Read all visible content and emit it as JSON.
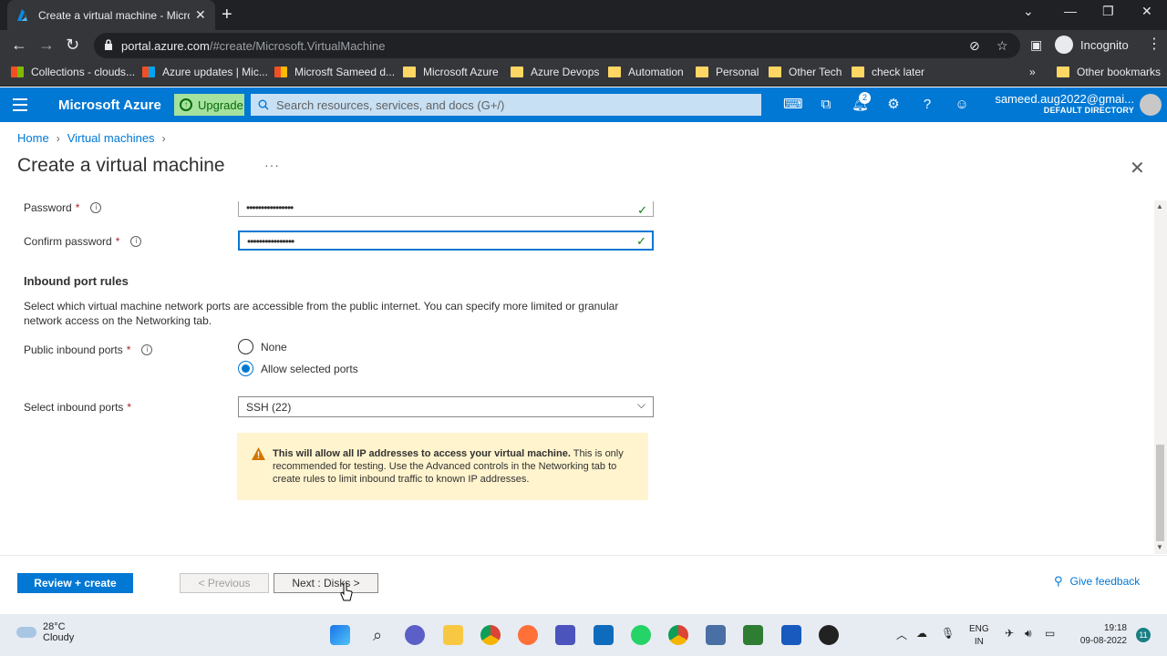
{
  "browser": {
    "tab_title": "Create a virtual machine - Micro",
    "url_host": "portal.azure.com",
    "url_path": "/#create/Microsoft.VirtualMachine",
    "profile": "Incognito",
    "bookmarks": [
      "Collections - clouds...",
      "Azure updates | Mic...",
      "Microsft Sameed d...",
      "Microsoft Azure",
      "Azure Devops",
      "Automation",
      "Personal",
      "Other Tech",
      "check later"
    ],
    "other_bookmarks": "Other bookmarks"
  },
  "azure": {
    "brand": "Microsoft Azure",
    "upgrade": "Upgrade",
    "search_placeholder": "Search resources, services, and docs (G+/)",
    "notification_count": "2",
    "user_email": "sameed.aug2022@gmai...",
    "user_directory": "DEFAULT DIRECTORY"
  },
  "page": {
    "breadcrumb": [
      "Home",
      "Virtual machines"
    ],
    "title": "Create a virtual machine",
    "more": "···"
  },
  "form": {
    "password_label": "Password",
    "password_value": "••••••••••••••••",
    "confirm_label": "Confirm password",
    "confirm_value": "••••••••••••••••",
    "section_title": "Inbound port rules",
    "section_desc": "Select which virtual machine network ports are accessible from the public internet. You can specify more limited or granular network access on the Networking tab.",
    "public_ports_label": "Public inbound ports",
    "option_none": "None",
    "option_allow": "Allow selected ports",
    "select_ports_label": "Select inbound ports",
    "select_ports_value": "SSH (22)",
    "warning_bold": "This will allow all IP addresses to access your virtual machine.",
    "warning_rest": " This is only recommended for testing.  Use the Advanced controls in the Networking tab to create rules to limit inbound traffic to known IP addresses."
  },
  "footer": {
    "review_create": "Review + create",
    "previous": "< Previous",
    "next": "Next : Disks >",
    "feedback": "Give feedback"
  },
  "taskbar": {
    "temperature": "28°C",
    "condition": "Cloudy",
    "lang1": "ENG",
    "lang2": "IN",
    "time": "19:18",
    "date": "09-08-2022",
    "notifications": "11"
  },
  "colors": {
    "azure_blue": "#0078d4",
    "upgrade_green": "#a4e29d",
    "warning_bg": "#fff4ce"
  }
}
